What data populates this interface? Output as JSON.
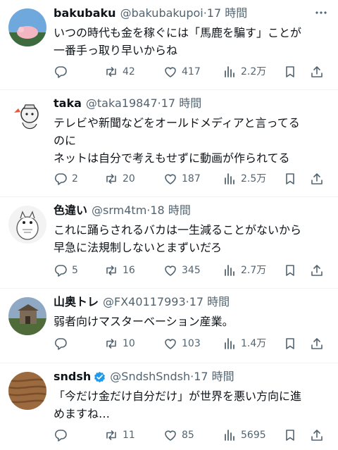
{
  "tweets": [
    {
      "name": "bakubaku",
      "handle": "@bakubakupoi",
      "time": "·17 時間",
      "verified": false,
      "text": "いつの時代も金を稼ぐには「馬鹿を騙す」ことが\n一番手っ取り早いからね",
      "replies": "",
      "retweets": "42",
      "likes": "417",
      "views": "2.2万"
    },
    {
      "name": "taka",
      "handle": "@taka19847",
      "time": "·17 時間",
      "verified": false,
      "text": "テレビや新聞などをオールドメディアと言ってる\nのに\nネットは自分で考えもせずに動画が作られてる",
      "replies": "2",
      "retweets": "20",
      "likes": "187",
      "views": "2.5万"
    },
    {
      "name": "色違い",
      "handle": "@srm4tm",
      "time": "·18 時間",
      "verified": false,
      "text": "これに踊らされるバカは一生減ることがないから\n早急に法規制しないとまずいだろ",
      "replies": "5",
      "retweets": "16",
      "likes": "345",
      "views": "2.7万"
    },
    {
      "name": "山奥トレ",
      "handle": "@FX40117993",
      "time": "·17 時間",
      "verified": false,
      "text": "弱者向けマスターベーション産業。",
      "replies": "",
      "retweets": "10",
      "likes": "103",
      "views": "1.4万"
    },
    {
      "name": "sndsh",
      "handle": "@SndshSndsh",
      "time": "·17 時間",
      "verified": true,
      "text": "「今だけ金だけ自分だけ」が世界を悪い方向に進\nめますね…",
      "replies": "",
      "retweets": "11",
      "likes": "85",
      "views": "5695"
    }
  ],
  "icons": {
    "reply": "reply-icon",
    "retweet": "retweet-icon",
    "like": "heart-icon",
    "views": "views-icon",
    "bookmark": "bookmark-icon",
    "share": "share-icon",
    "more": "more-icon"
  },
  "colors": {
    "text": "#0f1419",
    "secondary": "#536471",
    "verified": "#1d9bf0",
    "divider": "#eff3f4"
  }
}
